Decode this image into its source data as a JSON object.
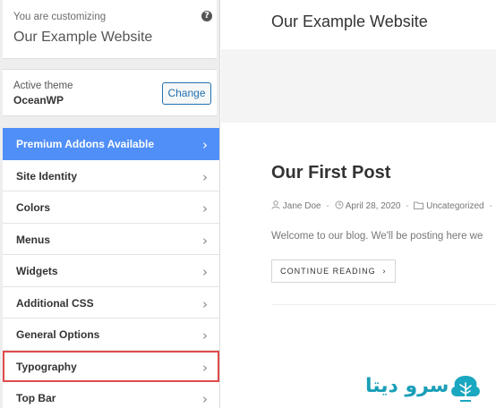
{
  "sidebar": {
    "customizing_label": "You are customizing",
    "site_name": "Our Example Website",
    "help_icon": "?",
    "theme": {
      "label": "Active theme",
      "name": "OceanWP",
      "change_label": "Change"
    },
    "items": [
      {
        "label": "Premium Addons Available",
        "style": "premium"
      },
      {
        "label": "Site Identity"
      },
      {
        "label": "Colors"
      },
      {
        "label": "Menus"
      },
      {
        "label": "Widgets"
      },
      {
        "label": "Additional CSS"
      },
      {
        "label": "General Options"
      },
      {
        "label": "Typography",
        "style": "highlight"
      },
      {
        "label": "Top Bar"
      }
    ],
    "chevron": "›"
  },
  "preview": {
    "site_title": "Our Example Website",
    "post": {
      "title": "Our First Post",
      "author": "Jane Doe",
      "date": "April 28, 2020",
      "category": "Uncategorized",
      "excerpt": "Welcome to our blog. We'll be posting here we",
      "cta": "CONTINUE READING"
    }
  },
  "watermark": {
    "text": "سرو دیتا"
  },
  "colors": {
    "premium": "#4f8ff7",
    "highlight": "#e04b4b",
    "button_border": "#2271b1"
  }
}
